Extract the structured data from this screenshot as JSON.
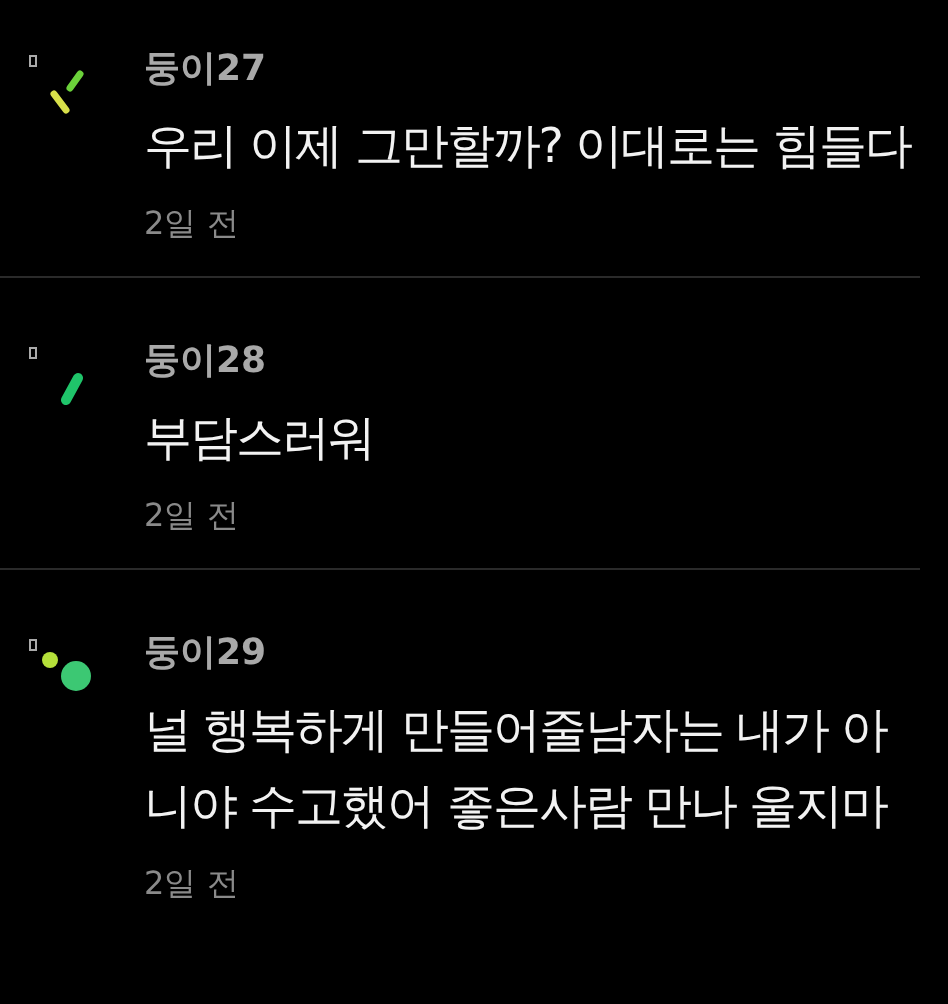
{
  "comments": [
    {
      "avatar": {
        "kind": "sticks"
      },
      "name": "둥이27",
      "text": "우리 이제 그만할까? 이대로는 힘들다",
      "time": "2일 전"
    },
    {
      "avatar": {
        "kind": "stick"
      },
      "name": "둥이28",
      "text": "부담스러워",
      "time": "2일 전"
    },
    {
      "avatar": {
        "kind": "dots"
      },
      "name": "둥이29",
      "text": "널 행복하게 만들어줄남자는 내가 아니야 수고했어 좋은사람 만나 울지마",
      "time": "2일 전"
    }
  ]
}
